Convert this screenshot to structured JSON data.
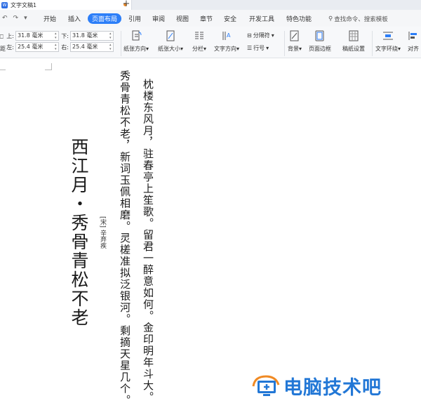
{
  "app": {
    "doc_title": "文字文稿1",
    "new_tab": "+"
  },
  "menu": {
    "items": [
      "开始",
      "插入",
      "页面布局",
      "引用",
      "审阅",
      "视图",
      "章节",
      "安全",
      "开发工具",
      "特色功能"
    ],
    "active": "页面布局",
    "search_placeholder": "查找命令、搜索模板"
  },
  "ribbon": {
    "margins": {
      "top_label": "上:",
      "top_value": "31.8 毫米",
      "bottom_label": "下:",
      "bottom_value": "31.8 毫米",
      "left_label": "左:",
      "left_value": "25.4 毫米",
      "right_label": "右:",
      "right_value": "25.4 毫米"
    },
    "left_cut_top": "距",
    "left_cut_bottom": "距",
    "buttons": {
      "orientation": "纸张方向",
      "size": "纸张大小",
      "columns": "分栏",
      "text_direction": "文字方向",
      "separator": "分隔符",
      "line_number": "行号",
      "background": "背景",
      "page_border": "页面边框",
      "paper_setting": "稿纸设置",
      "text_wrap": "文字环绕",
      "align": "对齐"
    }
  },
  "document": {
    "title": "西江月・秀骨青松不老",
    "author": "[宋] 辛弃疾",
    "lines": [
      "秀骨青松不老，新词玉佩相磨。灵槎准拟泛银河。剩摘天星几个。",
      "枕楼东风月，驻春亭上笙歌。留君一醉意如何。金印明年斗大。"
    ]
  },
  "watermark": {
    "text": "电脑技术吧"
  },
  "colors": {
    "accent": "#2c7ef8",
    "watermark_blue": "#2277d6",
    "watermark_orange": "#f08a24"
  }
}
